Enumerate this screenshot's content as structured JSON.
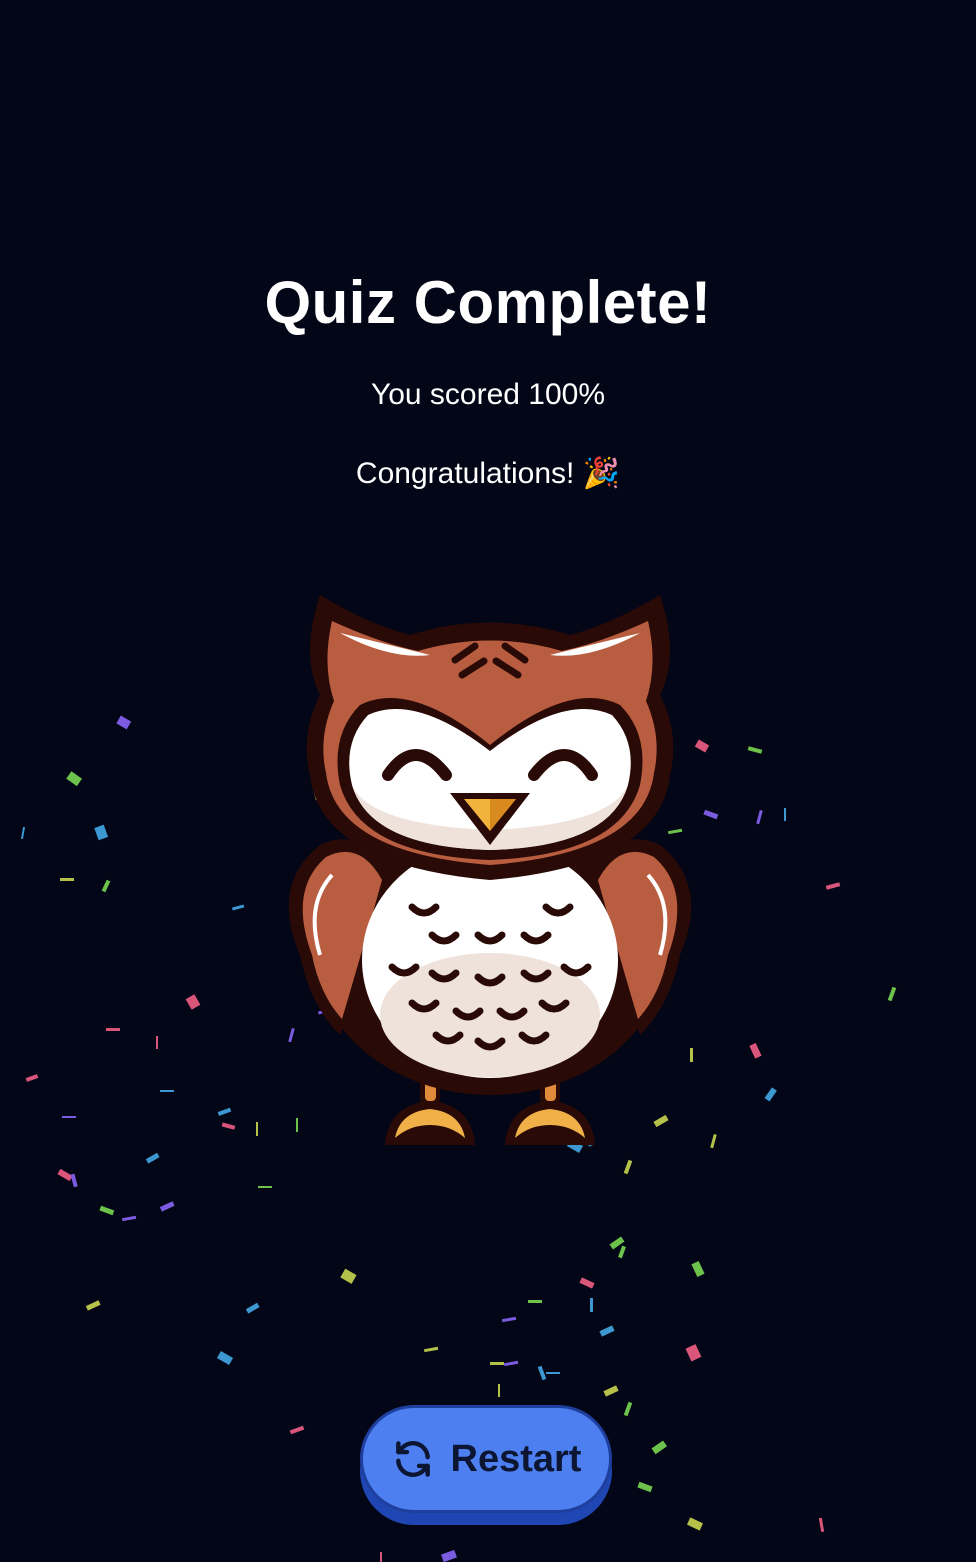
{
  "result": {
    "title": "Quiz Complete!",
    "score_text": "You scored 100%",
    "congrats_text": "Congratulations! 🎉"
  },
  "mascot": {
    "icon": "happy-owl-icon",
    "colors": {
      "feathers": "#b85d3f",
      "face": "#ffffff",
      "beak": "#f2b33d",
      "outline": "#2a0a06"
    }
  },
  "restart_button": {
    "label": "Restart",
    "icon": "refresh-icon",
    "color": "#4d7ff0"
  },
  "confetti_colors": [
    "#7b5be0",
    "#6cc24a",
    "#3d97d1",
    "#b6c14a",
    "#d9567a"
  ]
}
